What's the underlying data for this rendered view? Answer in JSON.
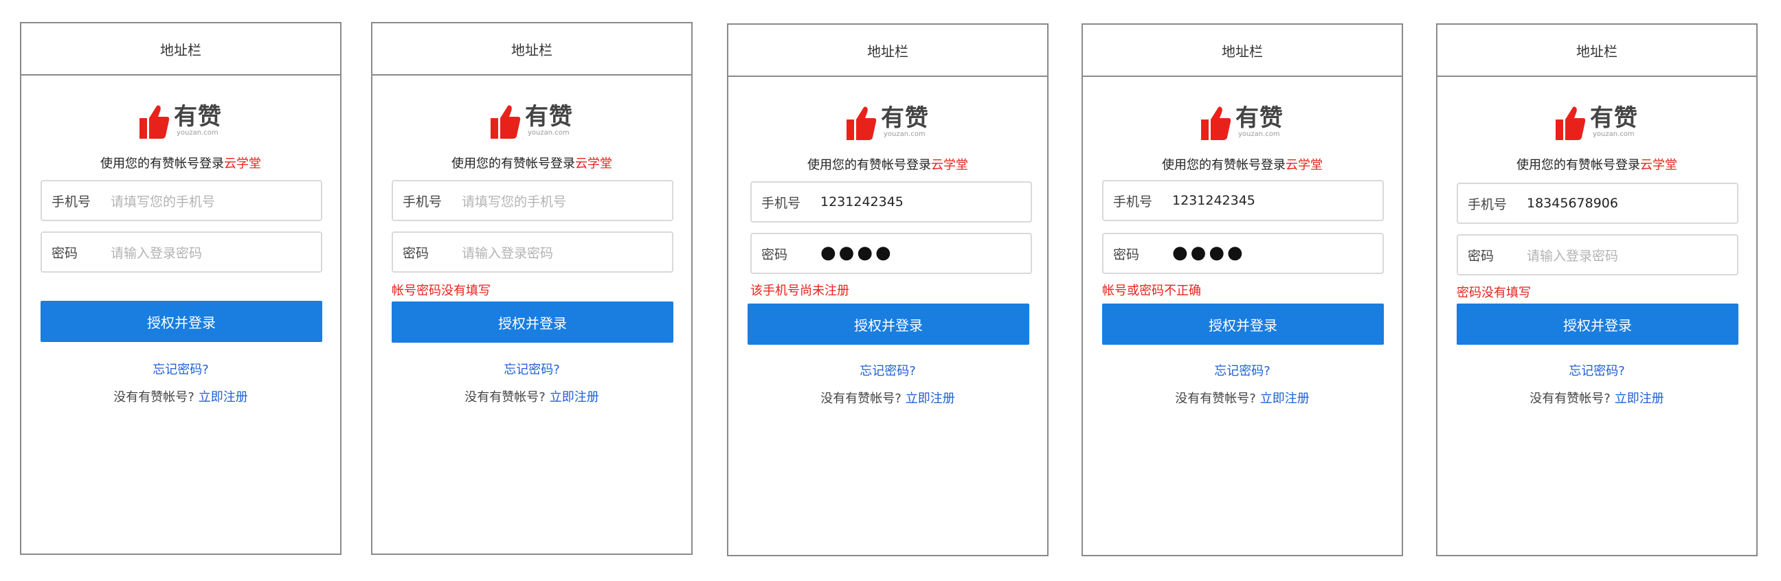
{
  "screens": [
    {
      "address_bar": "地址栏",
      "brand_cn": "有赞",
      "brand_en": "youzan.com",
      "tagline": "使用您的有赞帐号登录",
      "tagline_brand": "云学堂",
      "phone_label": "手机号",
      "phone_value": "请填写您的手机号",
      "password_label": "密码",
      "password_value": "请输入登录密码",
      "error": "",
      "login_button": "授权并登录",
      "forgot_link": "忘记密码?",
      "register_prompt": "没有有赞帐号?",
      "register_link": "立即注册"
    },
    {
      "address_bar": "地址栏",
      "brand_cn": "有赞",
      "brand_en": "youzan.com",
      "tagline": "使用您的有赞帐号登录",
      "tagline_brand": "云学堂",
      "phone_label": "手机号",
      "phone_value": "请填写您的手机号",
      "password_label": "密码",
      "password_value": "请输入登录密码",
      "error": "帐号密码没有填写",
      "login_button": "授权并登录",
      "forgot_link": "忘记密码?",
      "register_prompt": "没有有赞帐号?",
      "register_link": "立即注册"
    },
    {
      "address_bar": "地址栏",
      "brand_cn": "有赞",
      "brand_en": "youzan.com",
      "tagline": "使用您的有赞帐号登录",
      "tagline_brand": "云学堂",
      "phone_label": "手机号",
      "phone_value": "1231242345",
      "password_label": "密码",
      "password_value": "●●●●",
      "error": "该手机号尚未注册",
      "login_button": "授权并登录",
      "forgot_link": "忘记密码?",
      "register_prompt": "没有有赞帐号?",
      "register_link": "立即注册"
    },
    {
      "address_bar": "地址栏",
      "brand_cn": "有赞",
      "brand_en": "youzan.com",
      "tagline": "使用您的有赞帐号登录",
      "tagline_brand": "云学堂",
      "phone_label": "手机号",
      "phone_value": "1231242345",
      "password_label": "密码",
      "password_value": "●●●●",
      "error": "帐号或密码不正确",
      "login_button": "授权并登录",
      "forgot_link": "忘记密码?",
      "register_prompt": "没有有赞帐号?",
      "register_link": "立即注册"
    },
    {
      "address_bar": "地址栏",
      "brand_cn": "有赞",
      "brand_en": "youzan.com",
      "tagline": "使用您的有赞帐号登录",
      "tagline_brand": "云学堂",
      "phone_label": "手机号",
      "phone_value": "18345678906",
      "password_label": "密码",
      "password_value": "请输入登录密码",
      "error": "密码没有填写",
      "login_button": "授权并登录",
      "forgot_link": "忘记密码?",
      "register_prompt": "没有有赞帐号?",
      "register_link": "立即注册"
    }
  ],
  "colors": {
    "brand_red": "#e8221b",
    "button_blue": "#1a7de0",
    "link_blue": "#1f5fd6",
    "border_gray": "#8a8a8a"
  },
  "icons": {
    "logo": "thumbs-up-icon"
  }
}
